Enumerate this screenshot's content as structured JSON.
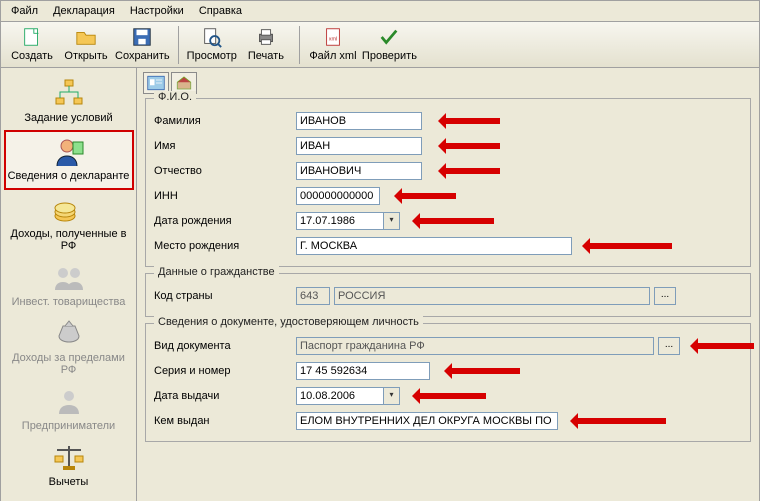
{
  "menu": {
    "file": "Файл",
    "decl": "Декларация",
    "settings": "Настройки",
    "help": "Справка"
  },
  "toolbar": {
    "create": "Создать",
    "open": "Открыть",
    "save": "Сохранить",
    "preview": "Просмотр",
    "print": "Печать",
    "xml": "Файл xml",
    "check": "Проверить"
  },
  "sidebar": {
    "conditions": "Задание условий",
    "declarant": "Сведения о декларанте",
    "income_rf": "Доходы, полученные в РФ",
    "invest": "Инвест. товарищества",
    "income_abroad": "Доходы за пределами РФ",
    "entrepreneurs": "Предприниматели",
    "deductions": "Вычеты"
  },
  "groups": {
    "fio": "Ф.И.О.",
    "citizenship": "Данные о гражданстве",
    "document": "Сведения о документе, удостоверяющем личность"
  },
  "labels": {
    "surname": "Фамилия",
    "name": "Имя",
    "patronymic": "Отчество",
    "inn": "ИНН",
    "dob": "Дата рождения",
    "pob": "Место рождения",
    "country_code": "Код страны",
    "doc_type": "Вид документа",
    "doc_sn": "Серия и номер",
    "doc_date": "Дата выдачи",
    "doc_issued": "Кем выдан"
  },
  "values": {
    "surname": "ИВАНОВ",
    "name": "ИВАН",
    "patronymic": "ИВАНОВИЧ",
    "inn": "000000000000",
    "dob": "17.07.1986",
    "pob": "Г. МОСКВА",
    "country_code": "643",
    "country_name": "РОССИЯ",
    "doc_type": "Паспорт гражданина РФ",
    "doc_sn": "17 45 592634",
    "doc_date": "10.08.2006",
    "doc_issued": "ЕЛОМ ВНУТРЕННИХ ДЕЛ ОКРУГА МОСКВЫ ПО ЦАО"
  }
}
